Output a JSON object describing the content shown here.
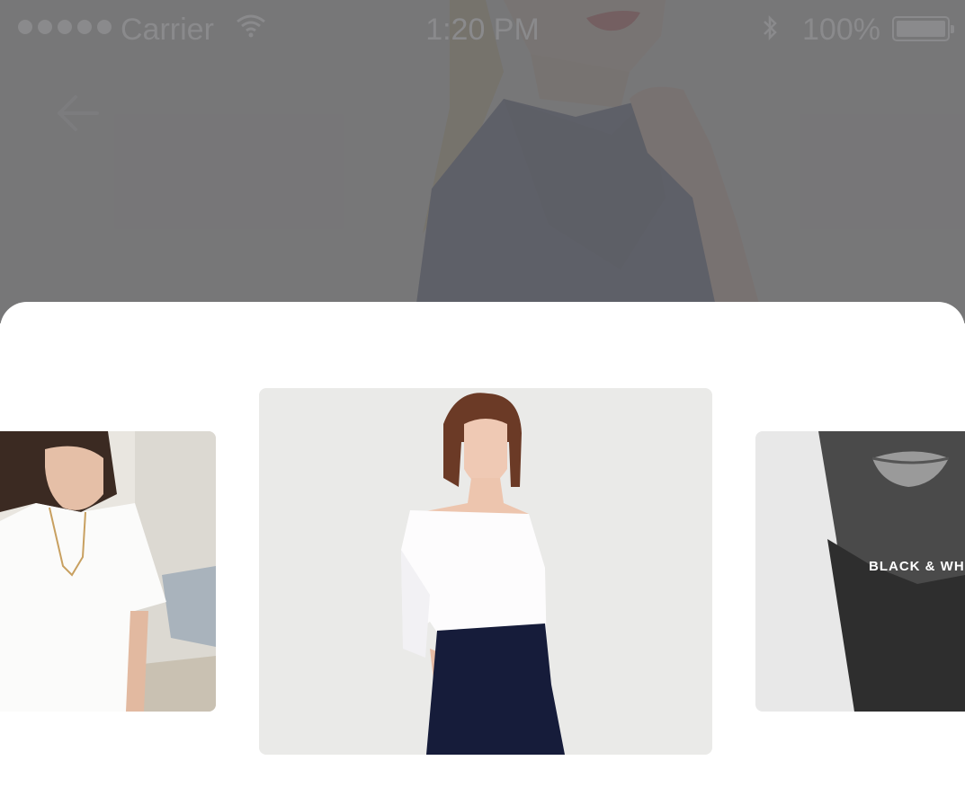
{
  "status_bar": {
    "carrier": "Carrier",
    "time": "1:20 PM",
    "battery": "100%"
  },
  "icons": {
    "back": "arrow-left-icon",
    "wifi": "wifi-icon",
    "bluetooth": "bluetooth-icon",
    "battery": "battery-icon"
  },
  "carousel": {
    "cards": [
      {
        "caption": ""
      },
      {
        "caption": ""
      },
      {
        "caption": "BLACK & WHI"
      }
    ]
  },
  "colors": {
    "overlay": "#666668",
    "sheet": "#ffffff",
    "navy": "#27306b",
    "lip": "#d42a35"
  }
}
